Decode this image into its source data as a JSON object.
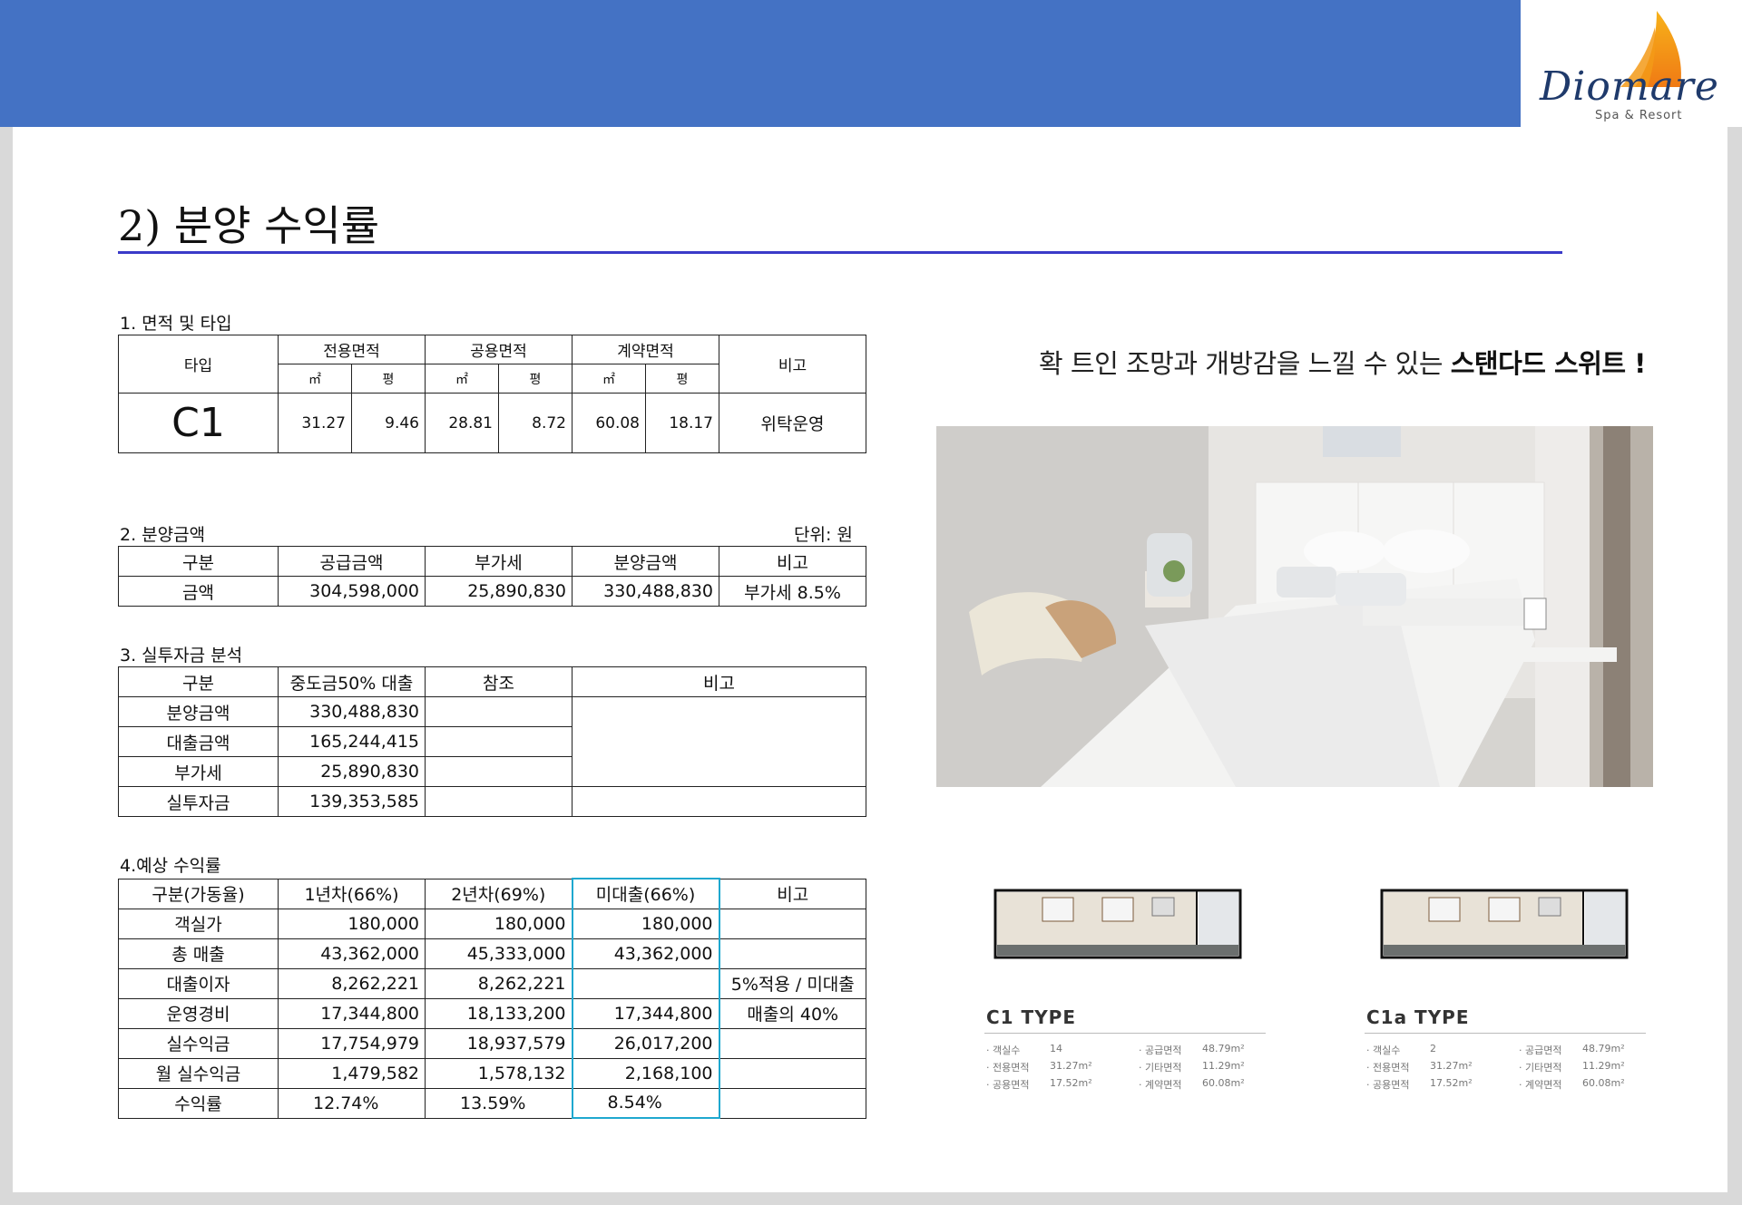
{
  "page": {
    "title": "2) 분양 수익률"
  },
  "logo": {
    "name": "Diomare",
    "sub": "Spa & Resort"
  },
  "section1": {
    "label": "1. 면적 및 타입",
    "headers": {
      "type": "타입",
      "exclusive": "전용면적",
      "common": "공용면적",
      "contract": "계약면적",
      "note": "비고",
      "sqm": "㎡",
      "pyeong": "평"
    },
    "row": {
      "type": "C1",
      "exclusive_sqm": "31.27",
      "exclusive_py": "9.46",
      "common_sqm": "28.81",
      "common_py": "8.72",
      "contract_sqm": "60.08",
      "contract_py": "18.17",
      "note": "위탁운영"
    }
  },
  "section2": {
    "label": "2. 분양금액",
    "unit": "단위: 원",
    "headers": [
      "구분",
      "공급금액",
      "부가세",
      "분양금액",
      "비고"
    ],
    "row": [
      "금액",
      "304,598,000",
      "25,890,830",
      "330,488,830",
      "부가세 8.5%"
    ]
  },
  "section3": {
    "label": "3. 실투자금 분석",
    "headers": [
      "구분",
      "중도금50% 대출",
      "참조",
      "비고"
    ],
    "rows": [
      [
        "분양금액",
        "330,488,830"
      ],
      [
        "대출금액",
        "165,244,415"
      ],
      [
        "부가세",
        "25,890,830"
      ],
      [
        "실투자금",
        "139,353,585"
      ]
    ]
  },
  "section4": {
    "label": "4.예상 수익률",
    "headers": [
      "구분(가동율)",
      "1년차(66%)",
      "2년차(69%)",
      "미대출(66%)",
      "비고"
    ],
    "rows": [
      [
        "객실가",
        "180,000",
        "180,000",
        "180,000",
        ""
      ],
      [
        "총 매출",
        "43,362,000",
        "45,333,000",
        "43,362,000",
        ""
      ],
      [
        "대출이자",
        "8,262,221",
        "8,262,221",
        "",
        "5%적용 / 미대출"
      ],
      [
        "운영경비",
        "17,344,800",
        "18,133,200",
        "17,344,800",
        "매출의 40%"
      ],
      [
        "실수익금",
        "17,754,979",
        "18,937,579",
        "26,017,200",
        ""
      ],
      [
        "월 실수익금",
        "1,479,582",
        "1,578,132",
        "2,168,100",
        ""
      ],
      [
        "수익률",
        "12.74%",
        "13.59%",
        "8.54%",
        ""
      ]
    ]
  },
  "headline": {
    "normal": "확 트인 조망과 개방감을 느낄 수 있는 ",
    "bold": "스탠다드 스위트 !"
  },
  "plans": [
    {
      "type": "C1 TYPE",
      "rooms_label": "· 객실수",
      "rooms": "14",
      "supply_label": "· 공급면적",
      "supply": "48.79m²",
      "excl_label": "· 전용면적",
      "excl": "31.27m²",
      "other_label": "· 기타면적",
      "other": "11.29m²",
      "common_label": "· 공용면적",
      "common": "17.52m²",
      "contract_label": "· 계약면적",
      "contract": "60.08m²"
    },
    {
      "type": "C1a TYPE",
      "rooms_label": "· 객실수",
      "rooms": "2",
      "supply_label": "· 공급면적",
      "supply": "48.79m²",
      "excl_label": "· 전용면적",
      "excl": "31.27m²",
      "other_label": "· 기타면적",
      "other": "11.29m²",
      "common_label": "· 공용면적",
      "common": "17.52m²",
      "contract_label": "· 계약면적",
      "contract": "60.08m²"
    }
  ],
  "colors": {
    "banner": "#4472c4",
    "rule": "#3a3ac8",
    "highlight": "#1fa8cf"
  }
}
